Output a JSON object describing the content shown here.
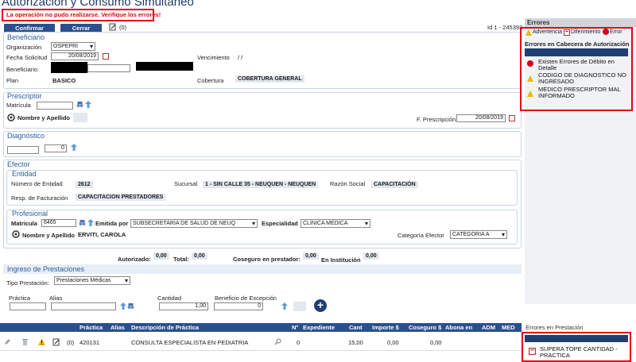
{
  "page_title": "Autorización y Consumo Simultáneo",
  "error_banner": "La operación no pudo realizarse. Verifique los errores!",
  "toolbar": {
    "confirm": "Confirmar",
    "close": "Cerrar",
    "notes_count": "(0)",
    "id_text": "Id 1 - 245393"
  },
  "beneficiario": {
    "title": "Beneficiario",
    "organizacion_label": "Organización",
    "organizacion_value": "OSPEPRI",
    "fecha_label": "Fecha Solicitud",
    "fecha_value": "20/08/2019",
    "vencimiento_label": "Vencimiento",
    "vencimiento_value": "/ /",
    "beneficiario_label": "Beneficiario",
    "plan_label": "Plan",
    "plan_value": "BASICO",
    "cobertura_label": "Cobertura",
    "cobertura_value": "COBERTURA GENERAL"
  },
  "prescriptor": {
    "title": "Prescriptor",
    "matricula_label": "Matrícula",
    "nombre_label": "Nombre y Apellido",
    "fecha_label": "F. Prescripción:",
    "fecha_value": "20/08/2019"
  },
  "diagnostico": {
    "title": "Diagnóstico",
    "code_value": "0"
  },
  "efector": {
    "title": "Efector",
    "entidad": {
      "title": "Entidad",
      "numero_label": "Número de Entidad",
      "numero_value": "2612",
      "sucursal_label": "Sucursal",
      "sucursal_value": "1 - SIN CALLE 35 - NEUQUEN - NEUQUEN",
      "razon_label": "Razón Social",
      "razon_value": "CAPACITACIÓN",
      "resp_label": "Resp. de Facturación",
      "resp_value": "CAPACITACION PRESTADORES"
    },
    "profesional": {
      "title": "Profesional",
      "matricula_label": "Matrícula",
      "matricula_value": "6465",
      "emitida_label": "Emitida por",
      "emitida_value": "SUBSECRETARIA DE SALUD DE NEUQ",
      "especialidad_label": "Especialidad",
      "especialidad_value": "CLINICA MEDICA",
      "nombre_label": "Nombre y Apellido",
      "nombre_value": "ERVITI, CAROLA",
      "categoria_label": "Categoría Efector",
      "categoria_value": "CATEGORIA A"
    }
  },
  "totals": {
    "autorizado_label": "Autorizado:",
    "autorizado_value": "0,00",
    "total_label": "Total:",
    "total_value": "0,00",
    "coseguro_label": "Coseguro en prestador:",
    "coseguro_value": "0,00",
    "institucion_label": "En Institución",
    "institucion_value": "0,00"
  },
  "ingreso": {
    "title": "Ingreso de Prestaciones",
    "tipo_label": "Tipo Prestación:",
    "tipo_value": "Prestaciones Médicas",
    "practica_label": "Práctica",
    "alias_label": "Alias",
    "cantidad_label": "Cantidad",
    "cantidad_value": "1,00",
    "beneficio_label": "Beneficio de Excepción",
    "beneficio_value": "0"
  },
  "grid": {
    "headers": [
      "Práctica",
      "Alias",
      "Descripción de Práctica",
      "N°",
      "Expediente",
      "Cant",
      "Importe $",
      "Coseguro $",
      "Abona en",
      "ADM",
      "MED"
    ],
    "row": {
      "notes": "(0)",
      "practica": "420131",
      "descripcion": "CONSULTA ESPECIALISTA EN PEDIATRIA",
      "nro": "0",
      "cant": "15,00",
      "importe": "0,00",
      "coseguro": "0,00"
    }
  },
  "errors_panel": {
    "title": "Errores",
    "legend": {
      "warning": "Advertencia",
      "deferral": "Diferimiento",
      "error": "Error"
    },
    "cabecera_title": "Errores en Cabecera de Autorización",
    "items": [
      "Existen Errores de Débito en Detalle",
      "CODIGO DE DIAGNOSTICO NO INGRESADO",
      "MEDICO PRESCRIPTOR MAL INFORMADO"
    ],
    "prestacion_title": "Errores en Prestación",
    "prestacion_items": [
      "SUPERA TOPE CANTIDAD - PRACTICA"
    ]
  },
  "colors": {
    "accent": "#2a4f8f",
    "error_red": "#e4001a",
    "section_title": "#2a5d9f"
  }
}
